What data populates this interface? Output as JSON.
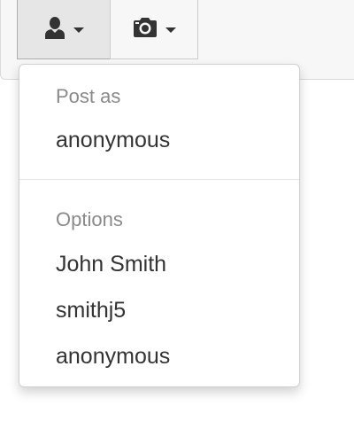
{
  "toolbar": {
    "user_button_icon": "user-icon",
    "camera_button_icon": "camera-icon"
  },
  "menu": {
    "post_as_header": "Post as",
    "post_as_items": [
      "anonymous"
    ],
    "options_header": "Options",
    "options_items": [
      "John Smith",
      "smithj5",
      "anonymous"
    ]
  },
  "colors": {
    "header_text": "#8a8a8a",
    "item_text": "#333333",
    "active_button_bg": "#e6e6e6"
  }
}
